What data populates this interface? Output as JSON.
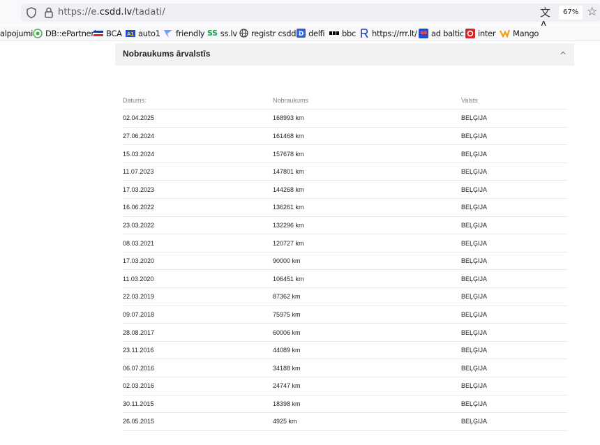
{
  "browser": {
    "url_prefix": "https://e.",
    "url_host": "csdd.lv",
    "url_path": "/tadati/",
    "translate_icon": "translate-icon",
    "zoom": "67%"
  },
  "bookmarks": [
    {
      "label": "alpojumi",
      "icon": "none"
    },
    {
      "label": "DB::ePartneri",
      "icon": "db-icon"
    },
    {
      "label": "BCA",
      "icon": "bca-icon"
    },
    {
      "label": "auto1",
      "icon": "auto1-icon"
    },
    {
      "label": "friendly",
      "icon": "friendly-icon"
    },
    {
      "label": "ss.lv",
      "icon": "ss-icon"
    },
    {
      "label": "registr csdd",
      "icon": "globe-icon"
    },
    {
      "label": "delfi",
      "icon": "delfi-icon"
    },
    {
      "label": "bbc",
      "icon": "bbc-icon"
    },
    {
      "label": "https://rrr.lt/",
      "icon": "rrr-icon"
    },
    {
      "label": "ad baltic",
      "icon": "ad-baltic-icon"
    },
    {
      "label": "inter",
      "icon": "inter-icon"
    },
    {
      "label": "Mango",
      "icon": "mango-icon"
    }
  ],
  "panel": {
    "title": "Nobraukums ārvalstīs"
  },
  "table": {
    "headers": [
      "Datums:",
      "Nobraukums",
      "Valsts"
    ],
    "rows": [
      [
        "02.04.2025",
        "168993 km",
        "BEĻĢIJA"
      ],
      [
        "27.06.2024",
        "161468 km",
        "BEĻĢIJA"
      ],
      [
        "15.03.2024",
        "157678 km",
        "BEĻĢIJA"
      ],
      [
        "11.07.2023",
        "147801 km",
        "BEĻĢIJA"
      ],
      [
        "17.03.2023",
        "144268 km",
        "BEĻĢIJA"
      ],
      [
        "16.06.2022",
        "136261 km",
        "BEĻĢIJA"
      ],
      [
        "23.03.2022",
        "132296 km",
        "BEĻĢIJA"
      ],
      [
        "08.03.2021",
        "120727 km",
        "BEĻĢIJA"
      ],
      [
        "17.03.2020",
        "90000 km",
        "BEĻĢIJA"
      ],
      [
        "11.03.2020",
        "106451 km",
        "BEĻĢIJA"
      ],
      [
        "22.03.2019",
        "87362 km",
        "BEĻĢIJA"
      ],
      [
        "09.07.2018",
        "75975 km",
        "BEĻĢIJA"
      ],
      [
        "28.08.2017",
        "60006 km",
        "BEĻĢIJA"
      ],
      [
        "23.11.2016",
        "44089 km",
        "BEĻĢIJA"
      ],
      [
        "06.07.2016",
        "34188 km",
        "BEĻĢIJA"
      ],
      [
        "02.03.2016",
        "24747 km",
        "BEĻĢIJA"
      ],
      [
        "30.11.2015",
        "18398 km",
        "BEĻĢIJA"
      ],
      [
        "26.05.2015",
        "4925 km",
        "BEĻĢIJA"
      ]
    ]
  }
}
